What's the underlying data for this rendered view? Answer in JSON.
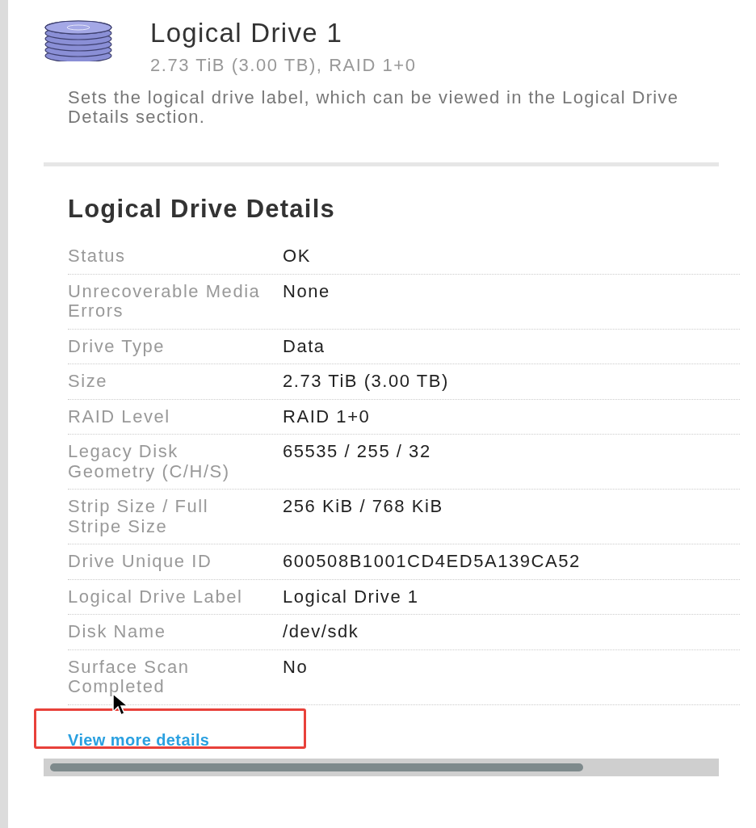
{
  "drive": {
    "title": "Logical Drive 1",
    "subtitle": "2.73 TiB (3.00 TB), RAID 1+0",
    "description": "Sets the logical drive label, which can be viewed in the Logical Drive Details section."
  },
  "details": {
    "heading": "Logical Drive Details",
    "rows": [
      {
        "label": "Status",
        "value": "OK"
      },
      {
        "label": "Unrecoverable Media Errors",
        "value": "None"
      },
      {
        "label": "Drive Type",
        "value": "Data"
      },
      {
        "label": "Size",
        "value": "2.73 TiB (3.00 TB)"
      },
      {
        "label": "RAID Level",
        "value": "RAID 1+0"
      },
      {
        "label": "Legacy Disk Geometry (C/H/S)",
        "value": "65535 / 255 / 32"
      },
      {
        "label": "Strip Size / Full Stripe Size",
        "value": "256 KiB / 768 KiB"
      },
      {
        "label": "Drive Unique ID",
        "value": "600508B1001CD4ED5A139CA52"
      },
      {
        "label": "Logical Drive Label",
        "value": "Logical Drive 1"
      },
      {
        "label": "Disk Name",
        "value": "/dev/sdk"
      },
      {
        "label": "Surface Scan Completed",
        "value": "No"
      }
    ],
    "link": "View more details"
  }
}
